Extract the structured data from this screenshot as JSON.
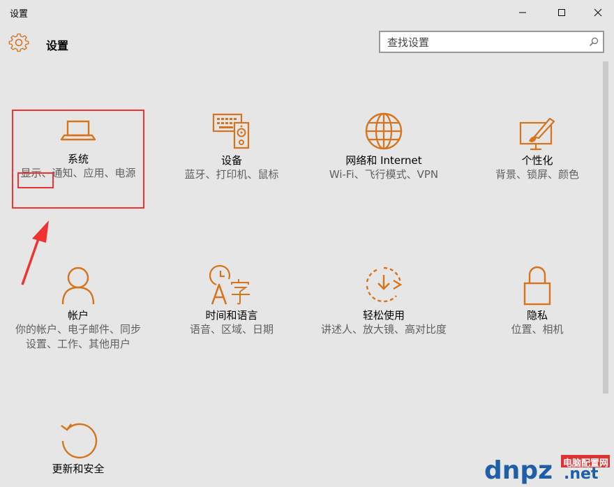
{
  "window": {
    "title": "设置"
  },
  "header": {
    "title": "设置"
  },
  "search": {
    "placeholder": "查找设置"
  },
  "colors": {
    "accent": "#d6731c",
    "highlight": "#e33333",
    "background": "#e6e6e6"
  },
  "tiles": [
    {
      "name": "系统",
      "desc": "显示、通知、应用、电源",
      "icon": "laptop-icon"
    },
    {
      "name": "设备",
      "desc": "蓝牙、打印机、鼠标",
      "icon": "devices-icon"
    },
    {
      "name": "网络和 Internet",
      "desc": "Wi-Fi、飞行模式、VPN",
      "icon": "globe-icon"
    },
    {
      "name": "个性化",
      "desc": "背景、锁屏、颜色",
      "icon": "paintbrush-icon"
    },
    {
      "name": "帐户",
      "desc": "你的帐户、电子邮件、同步设置、工作、其他用户",
      "icon": "person-icon"
    },
    {
      "name": "时间和语言",
      "desc": "语音、区域、日期",
      "icon": "time-language-icon"
    },
    {
      "name": "轻松使用",
      "desc": "讲述人、放大镜、高对比度",
      "icon": "ease-of-access-icon"
    },
    {
      "name": "隐私",
      "desc": "位置、相机",
      "icon": "lock-icon"
    },
    {
      "name": "更新和安全",
      "desc": "",
      "icon": "refresh-icon"
    }
  ],
  "watermark": {
    "brand": "dnpz.net",
    "tag": "电脑配置网"
  }
}
